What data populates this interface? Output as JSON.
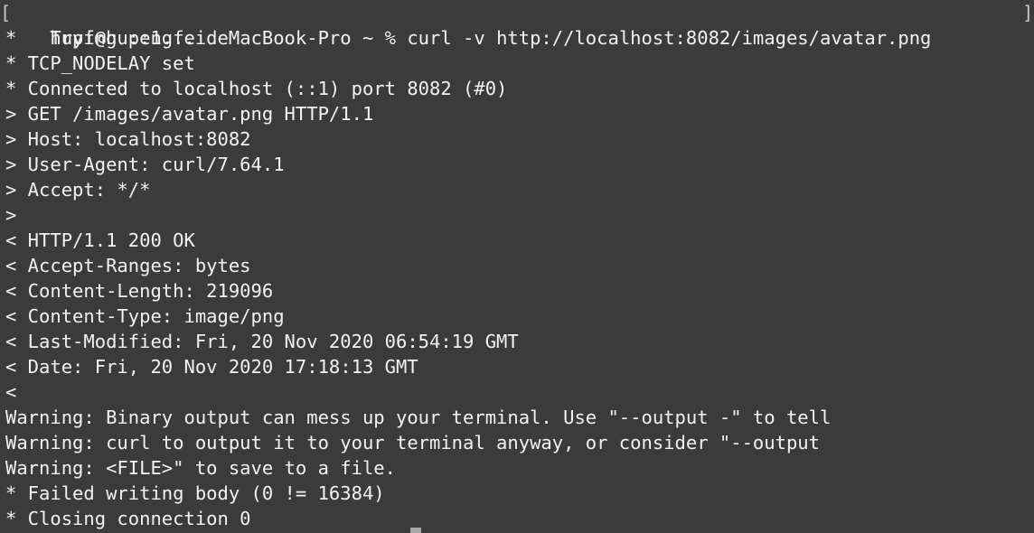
{
  "terminal": {
    "prompt": "hupf@hupengfeideMacBook-Pro ~ % ",
    "command": "curl -v http://localhost:8082/images/avatar.png",
    "bracket_left": "[",
    "bracket_right": "]",
    "lines": [
      "*   Trying ::1...",
      "* TCP_NODELAY set",
      "* Connected to localhost (::1) port 8082 (#0)",
      "> GET /images/avatar.png HTTP/1.1",
      "> Host: localhost:8082",
      "> User-Agent: curl/7.64.1",
      "> Accept: */*",
      ">",
      "< HTTP/1.1 200 OK",
      "< Accept-Ranges: bytes",
      "< Content-Length: 219096",
      "< Content-Type: image/png",
      "< Last-Modified: Fri, 20 Nov 2020 06:54:19 GMT",
      "< Date: Fri, 20 Nov 2020 17:18:13 GMT",
      "<",
      "Warning: Binary output can mess up your terminal. Use \"--output -\" to tell",
      "Warning: curl to output it to your terminal anyway, or consider \"--output",
      "Warning: <FILE>\" to save to a file.",
      "* Failed writing body (0 != 16384)",
      "* Closing connection 0"
    ],
    "colors": {
      "background": "#3b3b3b",
      "text": "#f2f2f2"
    }
  }
}
